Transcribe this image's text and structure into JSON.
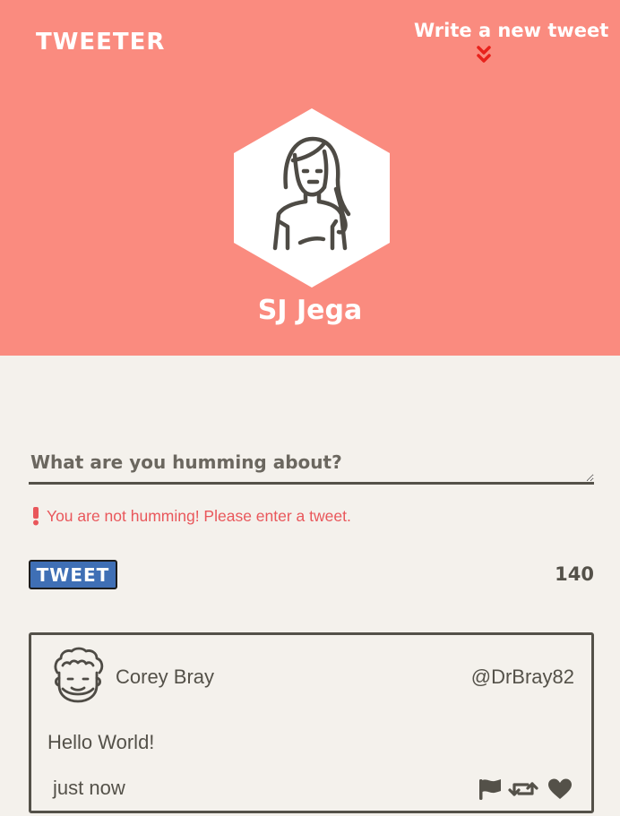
{
  "header": {
    "brand": "TWEETER",
    "compose_toggle_label": "Write a new tweet",
    "profile_name": "SJ Jega"
  },
  "compose": {
    "placeholder": "What are you humming about?",
    "value": "",
    "error_message": "You are not humming! Please enter a tweet.",
    "submit_label": "TWEET",
    "char_count": "140"
  },
  "tweets": [
    {
      "author_name": "Corey Bray",
      "handle": "@DrBray82",
      "content": "Hello World!",
      "timestamp": "just now",
      "actions": [
        "flag-icon",
        "retweet-icon",
        "heart-icon"
      ]
    }
  ],
  "colors": {
    "header_bg": "#fa8b7f",
    "page_bg": "#f4f1ec",
    "text_dark": "#545149",
    "error": "#e9575b",
    "button_bg": "#3f6fb5",
    "chevron": "#e8211b"
  }
}
